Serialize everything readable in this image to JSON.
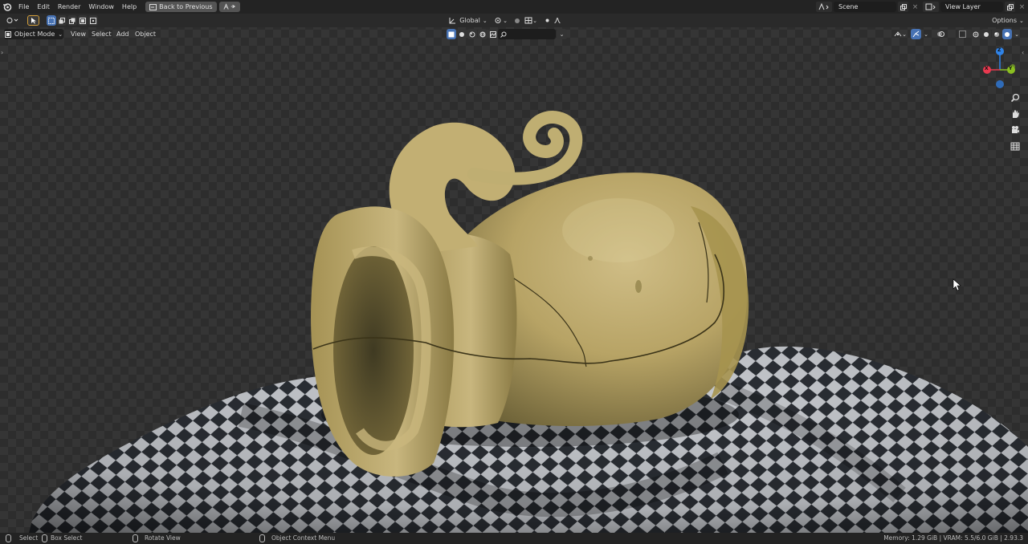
{
  "topbar": {
    "menus": [
      "File",
      "Edit",
      "Render",
      "Window",
      "Help"
    ],
    "back_label": "Back to Previous",
    "scene_value": "Scene",
    "view_layer_value": "View Layer"
  },
  "header": {
    "transform_orientation": "Global",
    "options_label": "Options"
  },
  "header2": {
    "mode_label": "Object Mode",
    "menus": [
      "View",
      "Select",
      "Add",
      "Object"
    ]
  },
  "gizmo": {
    "x_label": "X",
    "y_label": "Y",
    "z_label": "Z",
    "colors": {
      "x": "#e8394f",
      "y": "#8bbf21",
      "z": "#2f83e8"
    }
  },
  "statusbar": {
    "select": "Select",
    "box_select": "Box Select",
    "rotate_view": "Rotate View",
    "context_menu": "Object Context Menu",
    "stats": "Memory: 1.29 GiB | VRAM: 5.5/6.0 GiB | 2.93.3"
  },
  "colors": {
    "accent": "#4772b3",
    "pot": "#b8a468",
    "checker_light": "#c9ccd1",
    "checker_dark": "#2b2f35"
  }
}
